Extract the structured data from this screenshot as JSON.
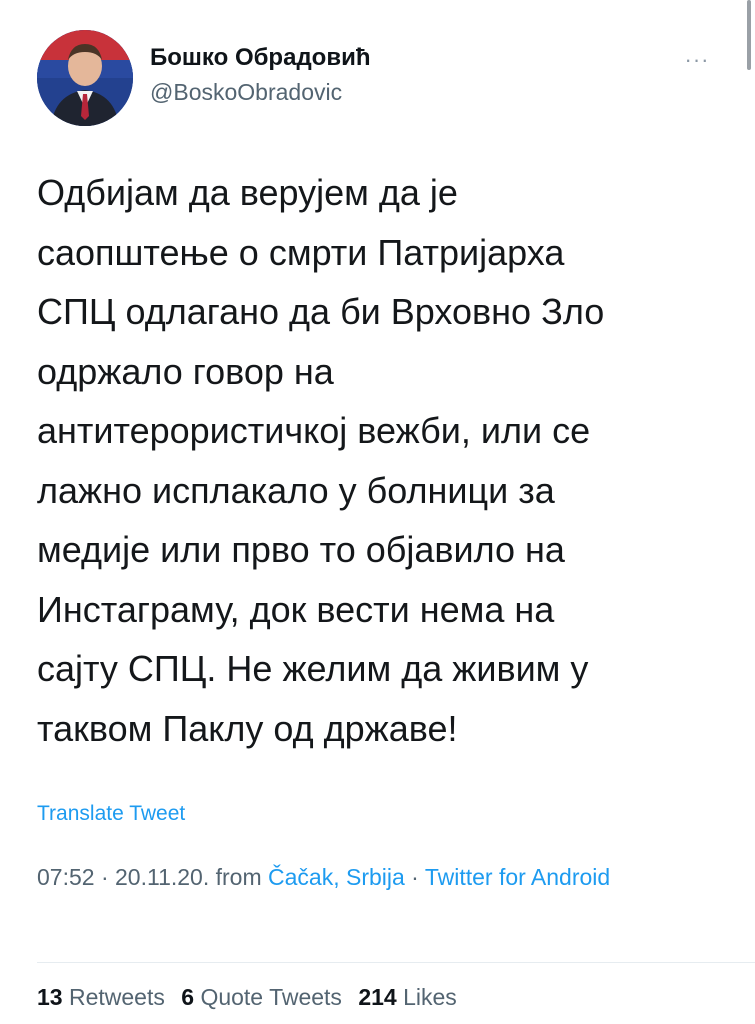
{
  "author": {
    "display_name": "Бошко Обрадовић",
    "handle": "@BoskoObradovic",
    "avatar_icon": "profile-photo"
  },
  "more_icon": "ellipsis-icon",
  "more_label": "···",
  "tweet": {
    "lines": [
      "Одбијам да верујем да је",
      "саопштење о смрти Патријарха",
      "СПЦ одлагано да би Врховно Зло",
      "одржало говор на",
      "антитерористичкој вежби, или се",
      "лажно исплакало у болници за",
      "медије или прво то објавило на",
      "Инстаграму, док вести нема на",
      "сајту СПЦ. Не желим да живим у",
      "таквом Паклу од државе!"
    ],
    "translate_label": "Translate Tweet"
  },
  "meta": {
    "time": "07:52",
    "sep1": " · ",
    "date": "20.11.20.",
    "from_label": " from ",
    "location": "Čačak, Srbija",
    "sep2": " · ",
    "source": "Twitter for Android"
  },
  "stats": {
    "retweets_count": "13",
    "retweets_label": "Retweets",
    "quotes_count": "6",
    "quotes_label": "Quote Tweets",
    "likes_count": "214",
    "likes_label": "Likes"
  },
  "colors": {
    "link": "#1d9bf0",
    "secondary_text": "#536471",
    "primary_text": "#0f1419"
  }
}
